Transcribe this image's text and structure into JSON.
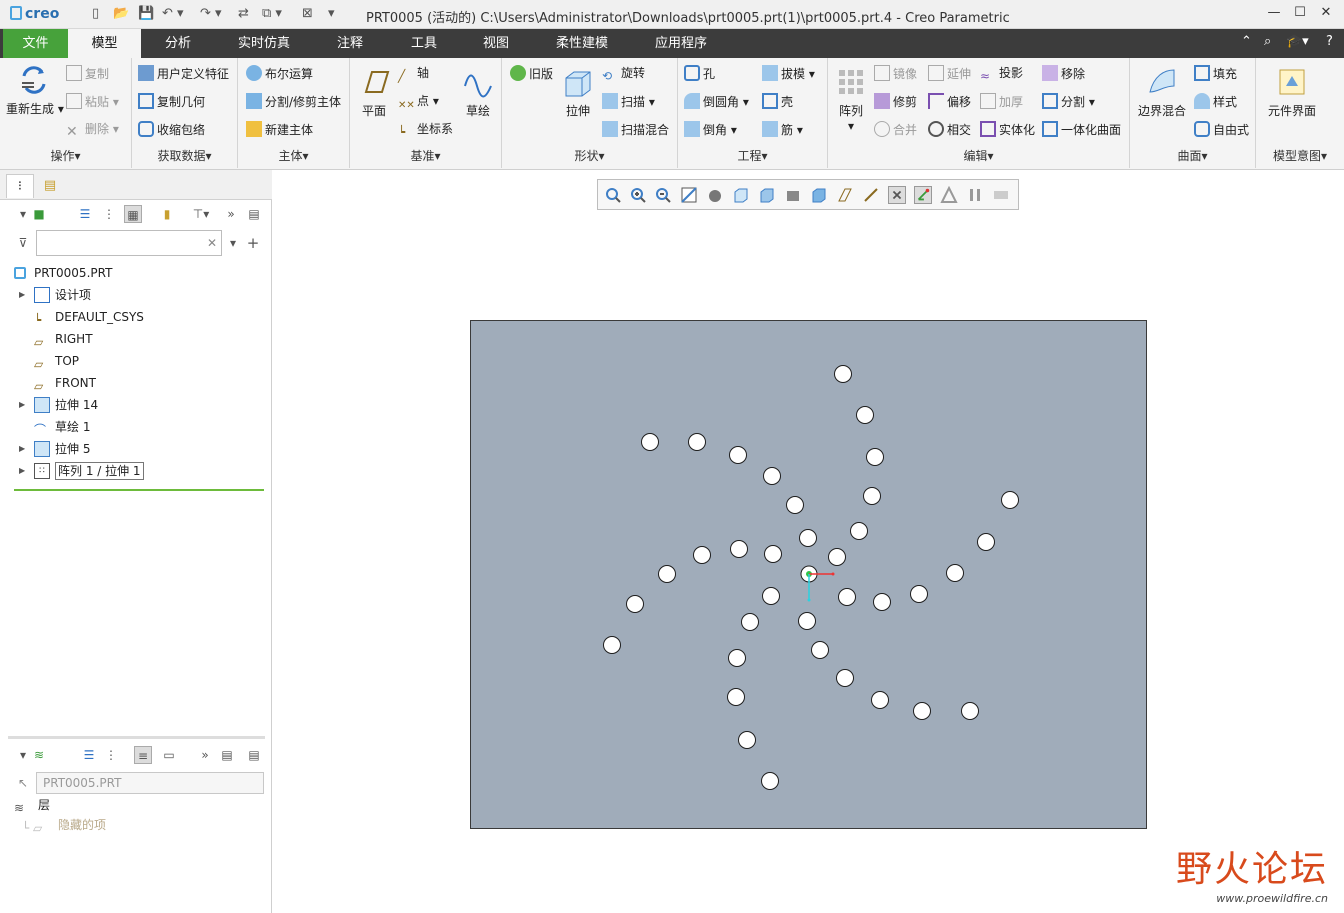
{
  "window": {
    "logo": "creo",
    "title": "PRT0005 (活动的) C:\\Users\\Administrator\\Downloads\\prt0005.prt(1)\\prt0005.prt.4 - Creo Parametric",
    "minimize": "—",
    "maximize": "☐",
    "close": "✕"
  },
  "menu": {
    "tabs": [
      "文件",
      "模型",
      "分析",
      "实时仿真",
      "注释",
      "工具",
      "视图",
      "柔性建模",
      "应用程序"
    ],
    "active": "模型"
  },
  "ribbon": {
    "groups": {
      "operations": {
        "label": "操作",
        "regenerate": "重新生成",
        "copy": "复制",
        "paste": "粘贴",
        "delete": "删除"
      },
      "get_data": {
        "label": "获取数据",
        "udf": "用户定义特征",
        "copy_geom": "复制几何",
        "shrinkwrap": "收缩包络"
      },
      "body": {
        "label": "主体",
        "boolean": "布尔运算",
        "split_trim": "分割/修剪主体",
        "new_body": "新建主体"
      },
      "datum": {
        "label": "基准",
        "plane": "平面",
        "axis": "轴",
        "point": "点",
        "csys": "坐标系",
        "sketch": "草绘"
      },
      "shapes": {
        "label": "形状",
        "legacy": "旧版",
        "extrude": "拉伸",
        "revolve": "旋转",
        "sweep": "扫描",
        "swept_blend": "扫描混合"
      },
      "engineering": {
        "label": "工程",
        "hole": "孔",
        "round": "倒圆角",
        "chamfer": "倒角",
        "draft": "拔模",
        "shell": "壳",
        "rib": "筋"
      },
      "editing": {
        "label": "编辑",
        "pattern": "阵列",
        "mirror": "镜像",
        "trim": "修剪",
        "merge": "合并",
        "extend": "延伸",
        "offset": "偏移",
        "intersect": "相交",
        "project": "投影",
        "thicken": "加厚",
        "solidify": "实体化",
        "remove": "移除",
        "split": "分割",
        "unify_surface": "一体化曲面"
      },
      "surfaces": {
        "label": "曲面",
        "boundary_blend": "边界混合",
        "fill": "填充",
        "style": "样式",
        "freestyle": "自由式"
      },
      "model_intent": {
        "label": "模型意图",
        "component_interface": "元件界面"
      }
    }
  },
  "model_tree": {
    "filter_placeholder": "",
    "root": "PRT0005.PRT",
    "items": [
      {
        "label": "设计项",
        "icon": "design-items-icon",
        "expandable": true
      },
      {
        "label": "DEFAULT_CSYS",
        "icon": "csys-icon",
        "expandable": false
      },
      {
        "label": "RIGHT",
        "icon": "datum-plane-icon",
        "expandable": false
      },
      {
        "label": "TOP",
        "icon": "datum-plane-icon",
        "expandable": false
      },
      {
        "label": "FRONT",
        "icon": "datum-plane-icon",
        "expandable": false
      },
      {
        "label": "拉伸 14",
        "icon": "extrude-icon",
        "expandable": true
      },
      {
        "label": "草绘 1",
        "icon": "sketch-icon",
        "expandable": false
      },
      {
        "label": "拉伸 5",
        "icon": "extrude-icon",
        "expandable": true
      },
      {
        "label": "阵列 1 / 拉伸 1",
        "icon": "pattern-icon",
        "expandable": true
      }
    ]
  },
  "layer_tree": {
    "model": "PRT0005.PRT",
    "root": "层",
    "hidden_items": "隐藏的项"
  },
  "watermark": {
    "main": "野火论坛",
    "sub": "www.proewildfire.cn"
  },
  "colors": {
    "menu_bg": "#3c3c3c",
    "file_tab": "#47a23b",
    "model_fill": "#a0acba",
    "insert_line": "#6dbb3b",
    "watermark": "#d84a1c"
  }
}
